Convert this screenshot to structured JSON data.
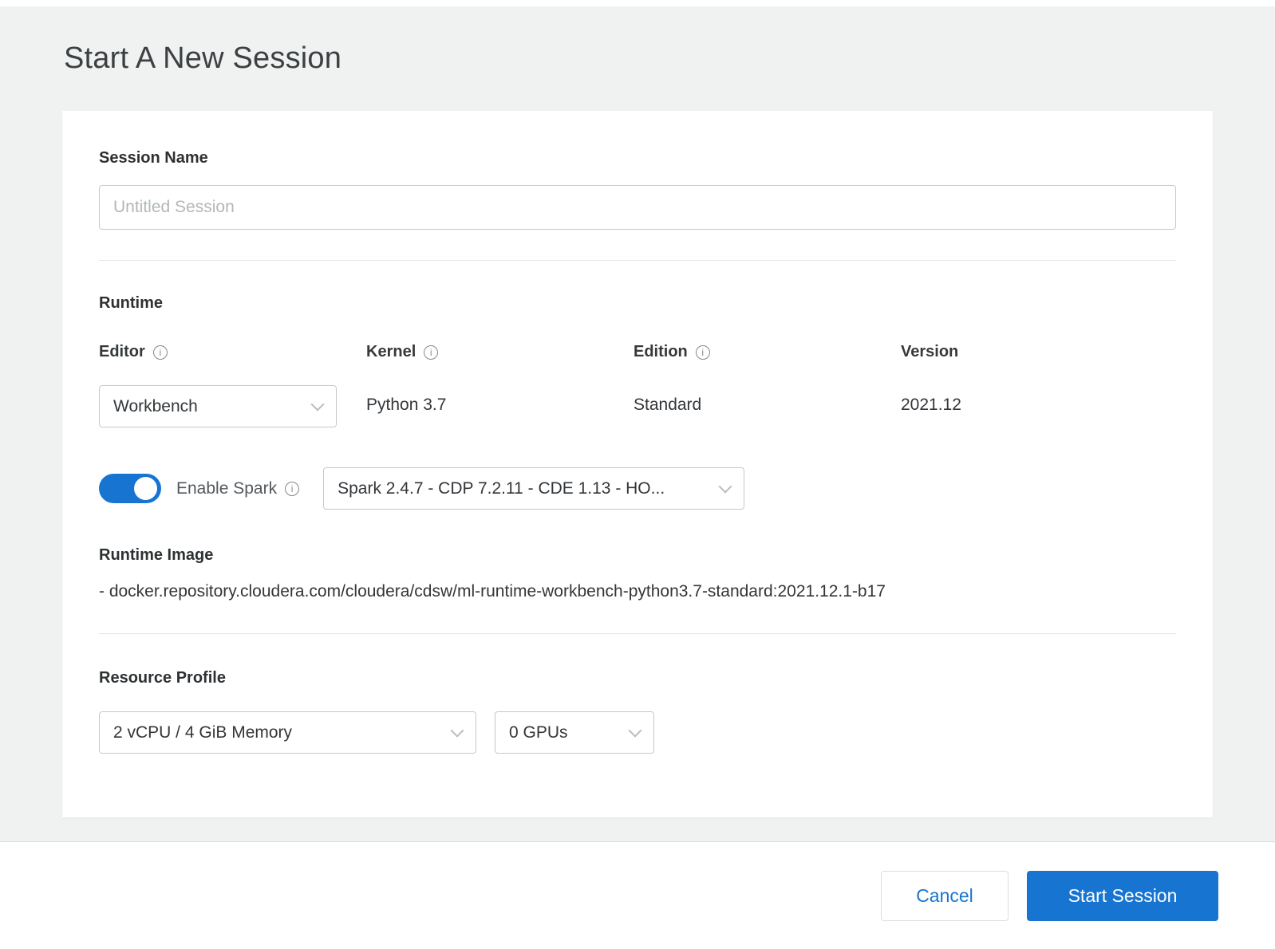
{
  "header": {
    "title": "Start A New Session"
  },
  "form": {
    "session_name": {
      "label": "Session Name",
      "placeholder": "Untitled Session",
      "value": ""
    },
    "runtime": {
      "heading": "Runtime",
      "editor": {
        "label": "Editor",
        "value": "Workbench"
      },
      "kernel": {
        "label": "Kernel",
        "value": "Python 3.7"
      },
      "edition": {
        "label": "Edition",
        "value": "Standard"
      },
      "version": {
        "label": "Version",
        "value": "2021.12"
      },
      "spark": {
        "label": "Enable Spark",
        "enabled": true,
        "selected_version": "Spark 2.4.7 - CDP 7.2.11 - CDE 1.13 - HO..."
      },
      "runtime_image": {
        "heading": "Runtime Image",
        "value": "- docker.repository.cloudera.com/cloudera/cdsw/ml-runtime-workbench-python3.7-standard:2021.12.1-b17"
      }
    },
    "resource_profile": {
      "heading": "Resource Profile",
      "profile_value": "2 vCPU / 4 GiB Memory",
      "gpu_value": "0 GPUs"
    }
  },
  "footer": {
    "cancel_label": "Cancel",
    "start_label": "Start Session"
  },
  "colors": {
    "accent_blue": "#1774d1",
    "page_background": "#f0f1f1",
    "card_background": "#ffffff",
    "border_gray": "#c4c9cd"
  }
}
